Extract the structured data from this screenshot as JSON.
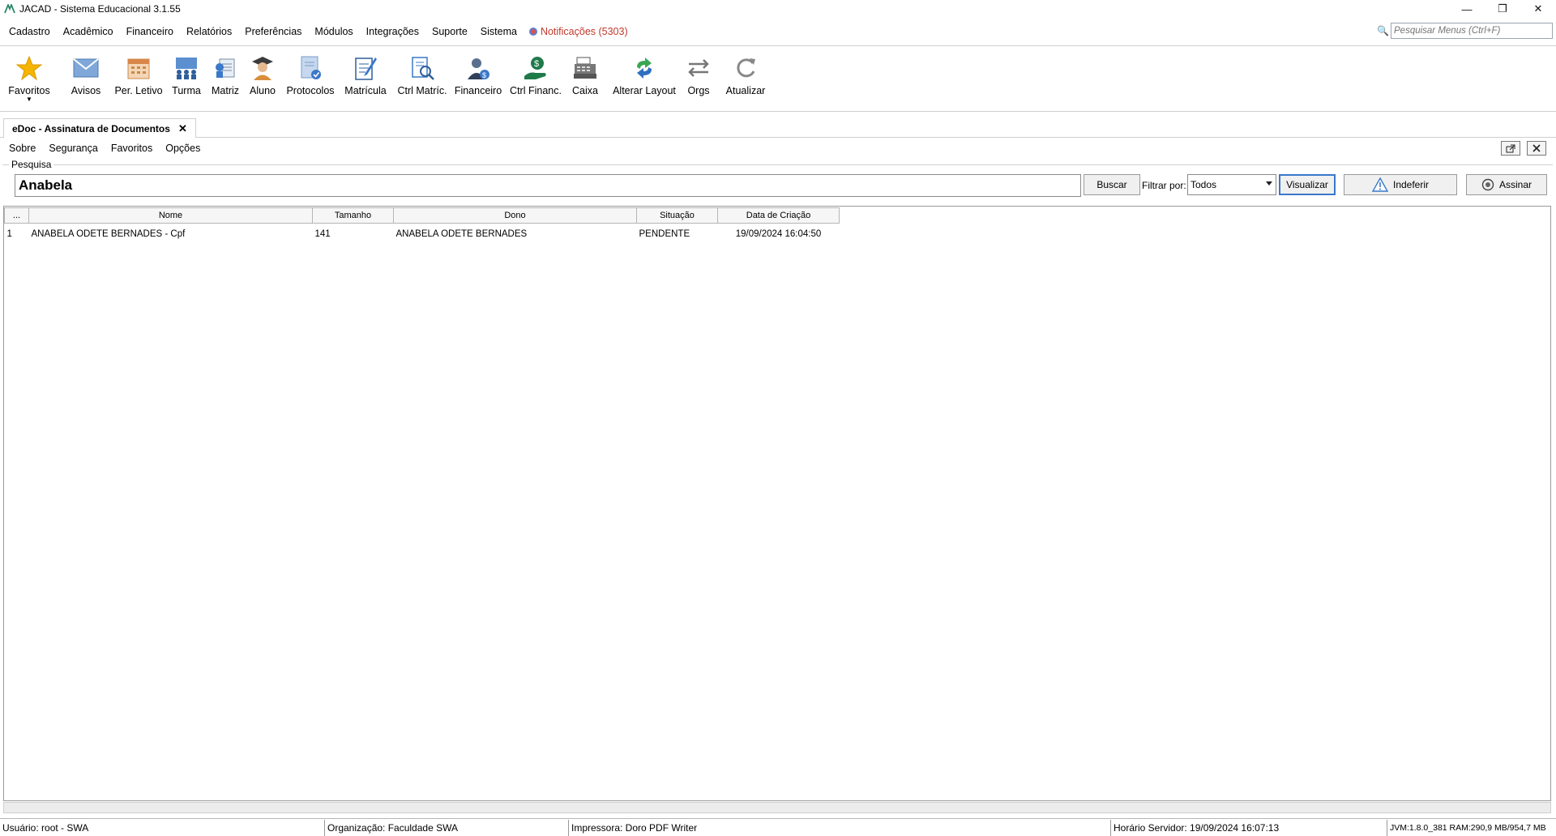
{
  "window": {
    "title": "JACAD - Sistema Educacional 3.1.55",
    "min_glyph": "—",
    "max_glyph": "❐",
    "close_glyph": "✕"
  },
  "menubar": {
    "items": [
      "Cadastro",
      "Acadêmico",
      "Financeiro",
      "Relatórios",
      "Preferências",
      "Módulos",
      "Integrações",
      "Suporte",
      "Sistema"
    ],
    "notifications": "Notificações (5303)",
    "search_placeholder": "Pesquisar Menus (Ctrl+F)"
  },
  "toolbar": {
    "items": [
      {
        "label": "Favoritos",
        "icon": "star-icon"
      },
      {
        "label": "Avisos",
        "icon": "envelope-icon"
      },
      {
        "label": "Per. Letivo",
        "icon": "calendar-icon"
      },
      {
        "label": "Turma",
        "icon": "class-group-icon"
      },
      {
        "label": "Matriz",
        "icon": "curriculum-icon"
      },
      {
        "label": "Aluno",
        "icon": "student-icon"
      },
      {
        "label": "Protocolos",
        "icon": "protocol-icon"
      },
      {
        "label": "Matrícula",
        "icon": "enrollment-icon"
      },
      {
        "label": "Ctrl Matríc.",
        "icon": "enrollment-control-icon"
      },
      {
        "label": "Financeiro",
        "icon": "finance-person-icon"
      },
      {
        "label": "Ctrl Financ.",
        "icon": "money-hand-icon"
      },
      {
        "label": "Caixa",
        "icon": "cash-register-icon"
      },
      {
        "label": "Alterar Layout",
        "icon": "layout-swap-icon"
      },
      {
        "label": "Orgs",
        "icon": "arrows-swap-icon"
      },
      {
        "label": "Atualizar",
        "icon": "refresh-icon"
      }
    ]
  },
  "tab": {
    "label": "eDoc - Assinatura de Documentos",
    "close": "✕"
  },
  "submenu": {
    "items": [
      "Sobre",
      "Segurança",
      "Favoritos",
      "Opções"
    ]
  },
  "search": {
    "legend": "Pesquisa",
    "value": "Anabela",
    "buscar": "Buscar",
    "filter_label": "Filtrar por:",
    "filter_value": "Todos",
    "visualizar": "Visualizar",
    "indeferir": "Indeferir",
    "assinar": "Assinar"
  },
  "table": {
    "headers": [
      "...",
      "Nome",
      "Tamanho",
      "Dono",
      "Situação",
      "Data de Criação"
    ],
    "rows": [
      [
        "1",
        "ANABELA ODETE BERNADES - Cpf",
        "141",
        "ANABELA ODETE BERNADES",
        "PENDENTE",
        "19/09/2024 16:04:50"
      ]
    ]
  },
  "statusbar": {
    "usuario": "Usuário: root - SWA",
    "organizacao": "Organização: Faculdade SWA",
    "impressora": "Impressora: Doro PDF Writer",
    "horario": "Horário Servidor: 19/09/2024 16:07:13",
    "jvm": "JVM:1.8.0_381  RAM:290,9 MB/954,7 MB"
  },
  "colors": {
    "accent": "#3a78c9",
    "notification": "#c0392b"
  }
}
